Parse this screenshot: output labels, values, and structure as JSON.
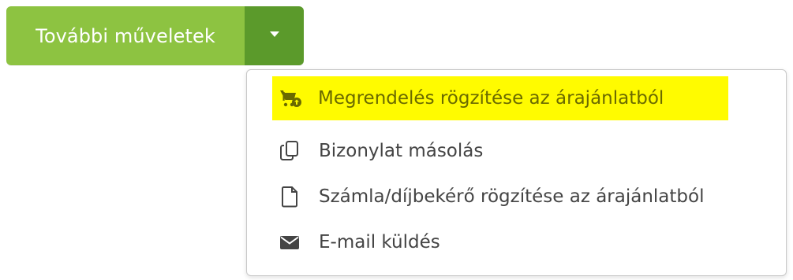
{
  "button": {
    "main_label": "További műveletek",
    "toggle_icon": "caret-down-icon"
  },
  "menu": {
    "items": [
      {
        "label": "Megrendelés rögzítése az árajánlatból",
        "icon": "cart-upload-icon",
        "highlighted": true
      },
      {
        "label": "Bizonylat másolás",
        "icon": "copy-icon",
        "highlighted": false
      },
      {
        "label": "Számla/díjbekérő rögzítése az árajánlatból",
        "icon": "document-icon",
        "highlighted": false
      },
      {
        "label": "E-mail küldés",
        "icon": "envelope-icon",
        "highlighted": false
      }
    ]
  },
  "colors": {
    "button_main": "#8dc341",
    "button_toggle": "#5b9a2b",
    "highlight": "#fffb00"
  }
}
